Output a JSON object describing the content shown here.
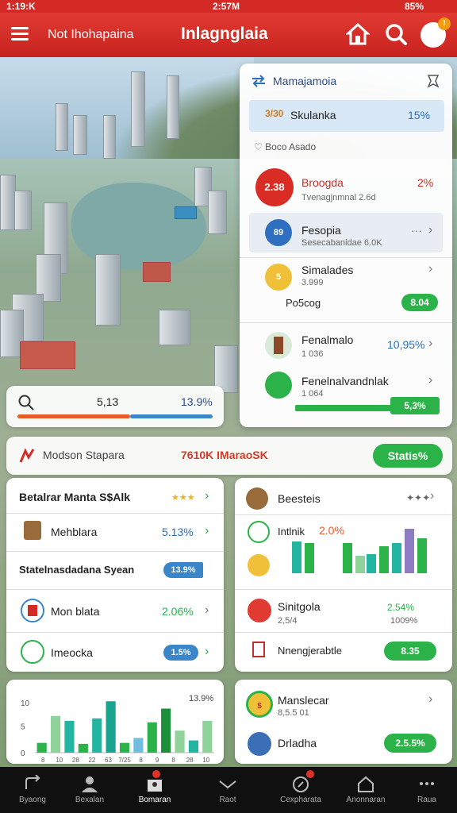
{
  "status": {
    "time_left": "1:19:K",
    "time_center": "2:57M",
    "battery": "85%"
  },
  "header": {
    "subtitle": "Not Ihohapaina",
    "title": "Inlagnglaia",
    "notification_count": "!"
  },
  "panel": {
    "title": "Mamajamoia",
    "highlight": {
      "badge": "3/30",
      "label": "Skulanka",
      "value": "15%"
    },
    "favorites_label": "Boco Asado",
    "items": [
      {
        "badge": "2.38",
        "name": "Broogda",
        "meta": "Tvenagjnmnal 2.6d",
        "value": "2%"
      },
      {
        "badge": "89",
        "name": "Fesopia",
        "meta": "Sesecabanidae 6.0K",
        "value": "···"
      },
      {
        "badge": "5",
        "name": "Simalades",
        "meta": "3.999",
        "sub": "Po5cog",
        "pill": "8.04"
      },
      {
        "badge": "",
        "name": "Fenalmalo",
        "meta": "1 036",
        "value": "10,95%"
      },
      {
        "badge": "",
        "name": "Fenelnalvandnlak",
        "meta": "1 064",
        "pill": "5,3%"
      }
    ]
  },
  "search": {
    "value": "5,13",
    "percent": "13.9%"
  },
  "strip": {
    "label": "Modson Stapara",
    "value": "7610K IMaraoSK",
    "button": "Statis%"
  },
  "card_left_top": {
    "title": "Betalrar Manta S$Alk",
    "rows": [
      {
        "name": "Mehblara",
        "value": "5.13%"
      },
      {
        "name": "Statelnasdadana Syean",
        "value": "13.9%"
      },
      {
        "name": "Mon blata",
        "value": "2.06%"
      },
      {
        "name": "Imeocka",
        "value": "1.5%"
      }
    ]
  },
  "card_right_top": {
    "title": "Beesteis",
    "row1": {
      "name": "Intlnik",
      "value": "2.0%"
    },
    "row3": {
      "name": "Sinitgola",
      "meta": "2,5/4",
      "v1": "2.54%",
      "v2": "1009%"
    },
    "row4": {
      "name": "Nnengjerabtle",
      "pill": "8.35"
    }
  },
  "chart_data": {
    "type": "bar",
    "ylabel": "",
    "y_ticks": [
      "10",
      "5",
      "0"
    ],
    "x_ticks": [
      "8",
      "10",
      "28",
      "22",
      "63",
      "7/25",
      "8",
      "9",
      "8",
      "28",
      "10"
    ],
    "peak_label": "13.9%",
    "values": [
      2,
      7.5,
      6.5,
      1.8,
      7,
      10.5,
      2,
      3,
      6.2,
      9,
      4.5,
      2.5,
      6.5
    ],
    "ylim": [
      0,
      12
    ]
  },
  "card_right_bottom": {
    "row1": {
      "name": "Manslecar",
      "meta": "8,5.5 01"
    },
    "row2": {
      "name": "Drladha",
      "pill": "2.5.5%"
    }
  },
  "nav": [
    {
      "label": "Byaong"
    },
    {
      "label": "Bexalan"
    },
    {
      "label": "Bomaran"
    },
    {
      "label": "Raot"
    },
    {
      "label": "Cexpharata"
    },
    {
      "label": "Anonnaran"
    },
    {
      "label": "Raua"
    }
  ],
  "colors": {
    "brand": "#d42a26",
    "accent_green": "#2bb34a",
    "accent_blue": "#3a86c8"
  }
}
